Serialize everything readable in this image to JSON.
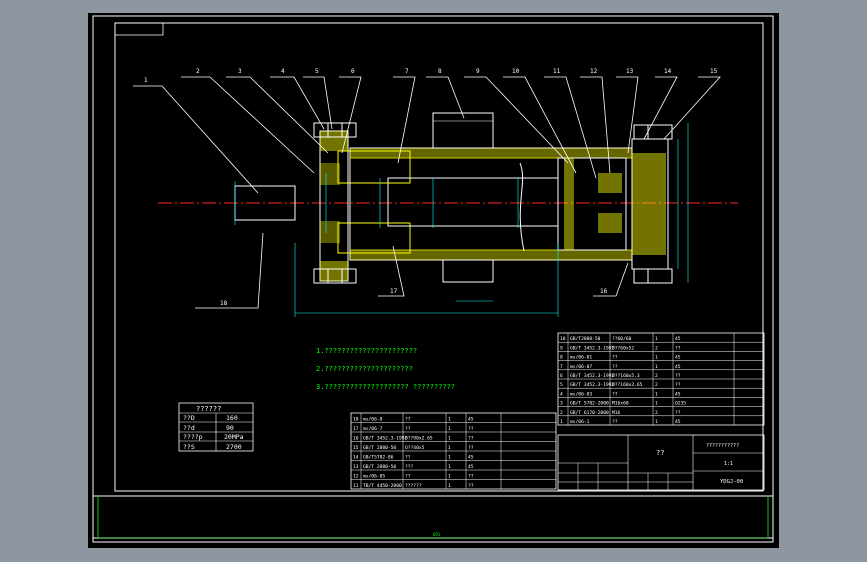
{
  "balloons": [
    "1",
    "2",
    "3",
    "4",
    "5",
    "6",
    "7",
    "8",
    "9",
    "10",
    "11",
    "12",
    "13",
    "14",
    "15"
  ],
  "lower_balloons": [
    "18",
    "17",
    "16"
  ],
  "notes": [
    "1.??????????????????????",
    "2.?????????????????????",
    "3.????????????????????  ??????????"
  ],
  "spec_table": {
    "title": "??????",
    "rows": [
      [
        "??D",
        "160"
      ],
      [
        "??d",
        "90"
      ],
      [
        "????p",
        "20MPa"
      ],
      [
        "??S",
        "2700"
      ]
    ]
  },
  "bom_upper": [
    [
      "10",
      "GB/T2880-50",
      "??60/60",
      "1",
      "45"
    ],
    [
      "9",
      "GB/T 3452.3-1992",
      "O??60x52",
      "2",
      "??"
    ],
    [
      "8",
      "ms/06-01",
      "??",
      "1",
      "45"
    ],
    [
      "7",
      "ms/06-07",
      "??",
      "1",
      "45"
    ],
    [
      "6",
      "GB/T 3452.3-1992",
      "O??160x5.3",
      "2",
      "??"
    ],
    [
      "5",
      "GB/T 3452.3-1992",
      "O??160x2.65",
      "2",
      "??"
    ],
    [
      "4",
      "ms/06-03",
      "??",
      "1",
      "45"
    ],
    [
      "3",
      "GB/T 5782-2000",
      "M16x60",
      "1",
      "Q235"
    ],
    [
      "2",
      "GB/T 6170-2000",
      "M16",
      "2",
      "??"
    ],
    [
      "1",
      "ms/06-1",
      "??",
      "1",
      "45"
    ]
  ],
  "bom_lower": [
    [
      "18",
      "ms/06-8",
      "??",
      "1",
      "45"
    ],
    [
      "17",
      "ms/06-7",
      "??",
      "1",
      "??"
    ],
    [
      "16",
      "GB/T 3452.3-1992",
      "O??90x2.65",
      "1",
      "??"
    ],
    [
      "15",
      "GB/T 2880-50",
      "O??40x5",
      "1",
      "??"
    ],
    [
      "14",
      "GB/T5782-86",
      "??",
      "1",
      "45"
    ],
    [
      "13",
      "GB/T 2880-50",
      "???",
      "1",
      "45"
    ],
    [
      "12",
      "ms/06-05",
      "??",
      "1",
      "??"
    ],
    [
      "11",
      "TB/T 4450-2000",
      "??????",
      "1",
      "??"
    ]
  ],
  "title_block": {
    "name": "??",
    "ratio": "1:1",
    "drawing_no": "YDGJ-00",
    "school": "???????????"
  },
  "bottom_dimension": "691"
}
